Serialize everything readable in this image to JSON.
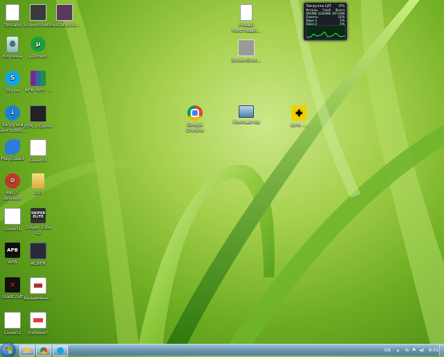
{
  "desktop_icons": [
    {
      "id": "pdslabs",
      "label": "ПВslabs",
      "icon": "document-icon",
      "color": "#ffffff"
    },
    {
      "id": "screenshot1",
      "label": "ScreenShot...",
      "icon": "image-icon",
      "color": "#3a3a3a"
    },
    {
      "id": "ihd",
      "label": "ihvstatyuhs...",
      "icon": "image-icon",
      "color": "#5a3a5a"
    },
    {
      "id": "new-text",
      "label": "Новый текстовый...",
      "icon": "text-file-icon",
      "color": "#ffffff"
    },
    {
      "id": "screenshot2",
      "label": "ScreenShot...",
      "icon": "image-icon",
      "color": "#9a9a9a"
    },
    {
      "id": "recycle",
      "label": "Корзина",
      "icon": "recycle-bin-icon",
      "color": "#b0c4d0"
    },
    {
      "id": "utorrent",
      "label": "µTorrent",
      "icon": "utorrent-icon",
      "color": "#1f9e3b"
    },
    {
      "id": "skype",
      "label": "Skype",
      "icon": "skype-icon",
      "color": "#11a5e5"
    },
    {
      "id": "apb-rar",
      "label": "APB_RPS_...",
      "icon": "winrar-icon",
      "color": "#7a2a8a"
    },
    {
      "id": "updates",
      "label": "Загрузки центр/Wil...",
      "icon": "download-icon",
      "color": "#1d7fd3"
    },
    {
      "id": "gamingroup",
      "label": "EFR 2 Game",
      "icon": "game-icon",
      "color": "#222222"
    },
    {
      "id": "chrome",
      "label": "Google Chrome",
      "icon": "chrome-icon",
      "color": "#db4437"
    },
    {
      "id": "computer",
      "label": "Компьютер",
      "icon": "computer-icon",
      "color": "#8aa8c8"
    },
    {
      "id": "lynx",
      "label": "Lynx_...",
      "icon": "puzzle-icon",
      "color": "#f1d000"
    },
    {
      "id": "playclaw",
      "label": "PlayClaw3",
      "icon": "playclaw-icon",
      "color": "#2d7cd8"
    },
    {
      "id": "skan3",
      "label": "Скайп3",
      "icon": "document-icon",
      "color": "#ffffff"
    },
    {
      "id": "4807",
      "label": "4807-deleted-",
      "icon": "stop-icon",
      "color": "#c0392b"
    },
    {
      "id": "gti",
      "label": "GTI",
      "icon": "folder-icon",
      "color": "#e8c45a"
    },
    {
      "id": "skan1",
      "label": "Скайп1",
      "icon": "document-icon",
      "color": "#ffffff"
    },
    {
      "id": "sniper",
      "label": "Sniper Elite V2",
      "icon": "sniper-icon",
      "color": "#333333"
    },
    {
      "id": "apb",
      "label": "APB",
      "icon": "apb-icon",
      "color": "#111111"
    },
    {
      "id": "acrp",
      "label": "ACRPR",
      "icon": "game-icon",
      "color": "#2a2a3a"
    },
    {
      "id": "gladcraft",
      "label": "GladCraft",
      "icon": "gladcraft-icon",
      "color": "#cc2222"
    },
    {
      "id": "bezymyanny",
      "label": "Безымянн...",
      "icon": "image-icon",
      "color": "#b03030"
    },
    {
      "id": "skan2",
      "label": "Скайп2",
      "icon": "document-icon",
      "color": "#ffffff"
    },
    {
      "id": "kabinet",
      "label": "Кабинет",
      "icon": "image-icon",
      "color": "#e04040"
    }
  ],
  "gadget": {
    "title": "Загрузка ЦП",
    "percent": "0%",
    "row1_left": "Исполь.",
    "row1_mid": "Своб.",
    "row1_right": "Всего",
    "row2_left": "985MB",
    "row2_mid": "2282MB",
    "row2_right": "3071MB",
    "row3_left": "Память",
    "row3_right": "32%",
    "row4_left": "Ядро 1",
    "row4_right": "0%",
    "row5_left": "Ядро 2",
    "row5_right": "0%"
  },
  "taskbar": {
    "lang": "EN",
    "time": "8:02",
    "pinned": [
      {
        "name": "explorer",
        "icon": "folder-icon"
      },
      {
        "name": "chrome",
        "icon": "chrome-icon"
      },
      {
        "name": "skype",
        "icon": "skype-icon"
      }
    ]
  }
}
